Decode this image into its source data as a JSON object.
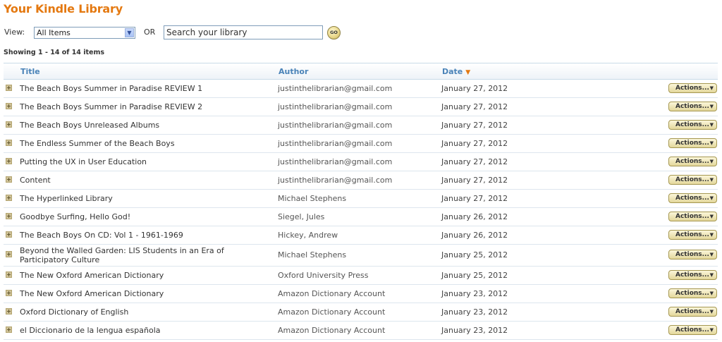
{
  "header": {
    "title": "Your Kindle Library"
  },
  "filter": {
    "view_label": "View:",
    "view_value": "All Items",
    "or_label": "OR",
    "search_placeholder": "Search your library",
    "go_label": "GO"
  },
  "showing": "Showing 1 - 14 of 14 items",
  "columns": {
    "title": "Title",
    "author": "Author",
    "date": "Date"
  },
  "actions_label": "Actions...",
  "rows": [
    {
      "title": "The Beach Boys Summer in Paradise REVIEW 1",
      "author": "justinthelibrarian@gmail.com",
      "date": "January 27, 2012"
    },
    {
      "title": "The Beach Boys Summer in Paradise REVIEW 2",
      "author": "justinthelibrarian@gmail.com",
      "date": "January 27, 2012"
    },
    {
      "title": "The Beach Boys Unreleased Albums",
      "author": "justinthelibrarian@gmail.com",
      "date": "January 27, 2012"
    },
    {
      "title": "The Endless Summer of the Beach Boys",
      "author": "justinthelibrarian@gmail.com",
      "date": "January 27, 2012"
    },
    {
      "title": "Putting the UX in User Education",
      "author": "justinthelibrarian@gmail.com",
      "date": "January 27, 2012"
    },
    {
      "title": "Content",
      "author": "justinthelibrarian@gmail.com",
      "date": "January 27, 2012"
    },
    {
      "title": "The Hyperlinked Library",
      "author": "Michael Stephens",
      "date": "January 27, 2012"
    },
    {
      "title": "Goodbye Surfing, Hello God!",
      "author": "Siegel, Jules",
      "date": "January 26, 2012"
    },
    {
      "title": "The Beach Boys On CD: Vol 1 - 1961-1969",
      "author": "Hickey, Andrew",
      "date": "January 26, 2012"
    },
    {
      "title": "Beyond the Walled Garden: LIS Students in an Era of Participatory Culture",
      "author": "Michael Stephens",
      "date": "January 25, 2012"
    },
    {
      "title": "The New Oxford American Dictionary",
      "author": "Oxford University Press",
      "date": "January 25, 2012"
    },
    {
      "title": "The New Oxford American Dictionary",
      "author": "Amazon Dictionary Account",
      "date": "January 23, 2012"
    },
    {
      "title": "Oxford Dictionary of English",
      "author": "Amazon Dictionary Account",
      "date": "January 23, 2012"
    },
    {
      "title": "el Diccionario de la lengua española",
      "author": "Amazon Dictionary Account",
      "date": "January 23, 2012"
    }
  ]
}
